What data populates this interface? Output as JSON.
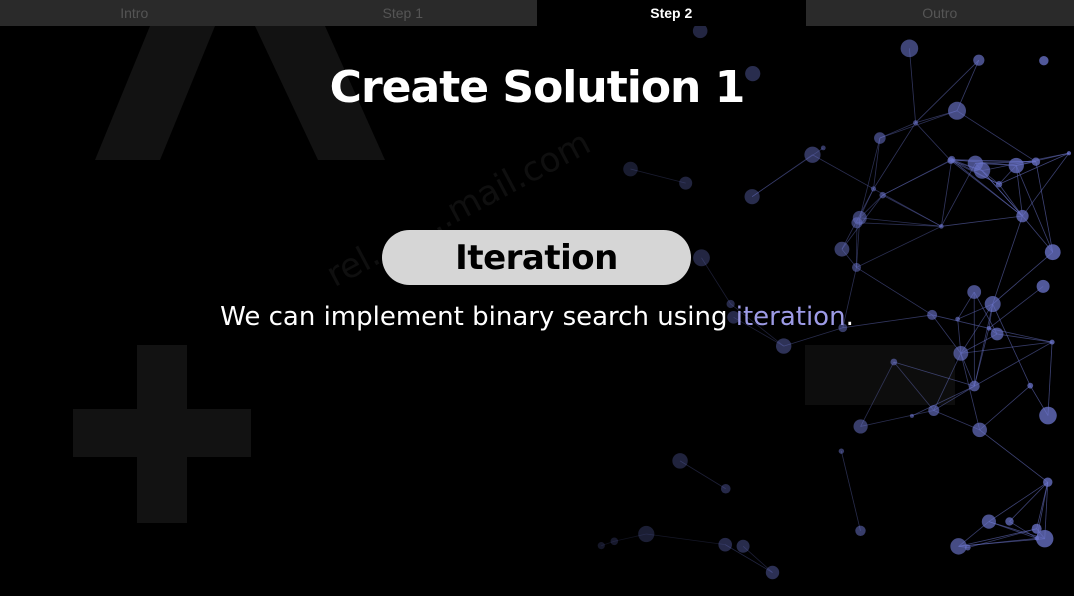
{
  "tabs": [
    {
      "label": "Intro",
      "active": false
    },
    {
      "label": "Step 1",
      "active": false
    },
    {
      "label": "Step 2",
      "active": true
    },
    {
      "label": "Outro",
      "active": false
    }
  ],
  "slide": {
    "title": "Create Solution 1",
    "pill_label": "Iteration",
    "body_prefix": "We can implement binary search using ",
    "body_highlight": "iteration",
    "body_suffix": "."
  },
  "colors": {
    "background": "#000000",
    "highlight": "#9d9be6",
    "pill": "#d6d6d6",
    "network": "#6a73c9"
  }
}
